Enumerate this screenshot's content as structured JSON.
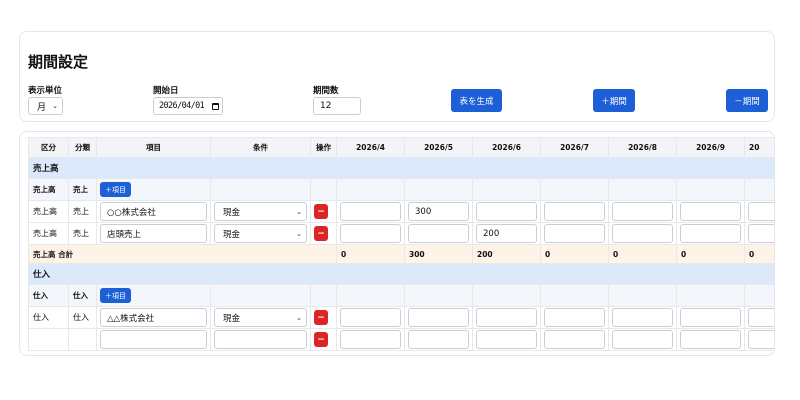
{
  "settings": {
    "title": "期間設定",
    "unit_label": "表示単位",
    "unit_value": "月",
    "start_label": "開始日",
    "start_value": "2026/04/01",
    "count_label": "期間数",
    "count_value": "12",
    "generate_label": "表を生成",
    "add_period_label": "＋期間",
    "remove_period_label": "－期間"
  },
  "table": {
    "headers": [
      "区分",
      "分類",
      "項目",
      "条件",
      "操作",
      "2026/4",
      "2026/5",
      "2026/6",
      "2026/7",
      "2026/8",
      "2026/9",
      "20"
    ],
    "add_item_label": "＋項目",
    "delete_label": "−",
    "sections": [
      {
        "name": "売上高",
        "sub_category": "売上高",
        "sub_class": "売上",
        "items": [
          {
            "category": "売上高",
            "class": "売上",
            "name": "○○株式会社",
            "condition": "現金",
            "values": [
              "",
              "300",
              "",
              "",
              "",
              "",
              ""
            ]
          },
          {
            "category": "売上高",
            "class": "売上",
            "name": "店頭売上",
            "condition": "現金",
            "values": [
              "",
              "",
              "200",
              "",
              "",
              "",
              ""
            ]
          }
        ],
        "total_label": "売上高 合計",
        "totals": [
          "0",
          "300",
          "200",
          "0",
          "0",
          "0",
          "0"
        ]
      },
      {
        "name": "仕入",
        "sub_category": "仕入",
        "sub_class": "仕入",
        "items": [
          {
            "category": "仕入",
            "class": "仕入",
            "name": "△△株式会社",
            "condition": "現金",
            "values": [
              "",
              "",
              "",
              "",
              "",
              "",
              ""
            ]
          }
        ]
      }
    ]
  },
  "colors": {
    "primary": "#1d5fd6",
    "danger": "#dc2626",
    "section_bg": "#dbe9fb",
    "total_bg": "#fdf3e6"
  }
}
